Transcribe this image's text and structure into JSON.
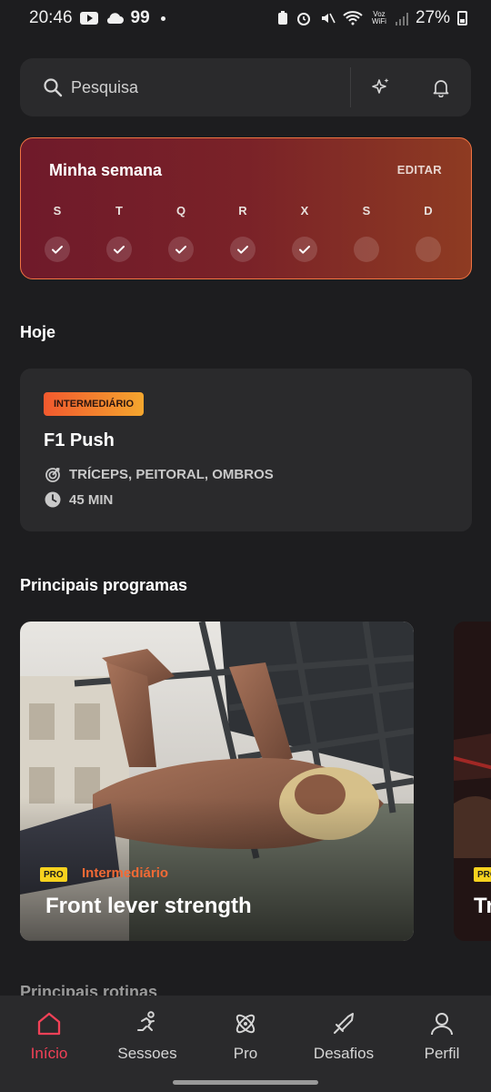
{
  "status_bar": {
    "time": "20:46",
    "notification_count": "99",
    "voz_wifi": "Voz WiFi",
    "battery": "27%"
  },
  "search": {
    "placeholder": "Pesquisa"
  },
  "week": {
    "title": "Minha semana",
    "edit_label": "EDITAR",
    "days": [
      {
        "label": "S",
        "done": true
      },
      {
        "label": "T",
        "done": true
      },
      {
        "label": "Q",
        "done": true
      },
      {
        "label": "R",
        "done": true
      },
      {
        "label": "X",
        "done": true
      },
      {
        "label": "S",
        "done": false
      },
      {
        "label": "D",
        "done": false
      }
    ]
  },
  "today": {
    "section_title": "Hoje",
    "level": "INTERMEDIÁRIO",
    "title": "F1 Push",
    "muscles": "TRÍCEPS, PEITORAL, OMBROS",
    "duration": "45 MIN"
  },
  "programs": {
    "section_title": "Principais programas",
    "items": [
      {
        "badge": "PRO",
        "level": "Intermediário",
        "title": "Front lever strength"
      },
      {
        "badge": "PRO",
        "level": "",
        "title": "Tr"
      }
    ]
  },
  "routines": {
    "section_title": "Principais rotinas"
  },
  "nav": {
    "items": [
      {
        "label": "Início",
        "icon": "home-icon",
        "active": true
      },
      {
        "label": "Sessoes",
        "icon": "running-icon",
        "active": false
      },
      {
        "label": "Pro",
        "icon": "atom-icon",
        "active": false
      },
      {
        "label": "Desafios",
        "icon": "sword-icon",
        "active": false
      },
      {
        "label": "Perfil",
        "icon": "person-icon",
        "active": false
      }
    ]
  },
  "colors": {
    "accent": "#f24157",
    "week_border": "#f27442",
    "pro_badge": "#f7d21e",
    "level_text": "#f26a35"
  }
}
